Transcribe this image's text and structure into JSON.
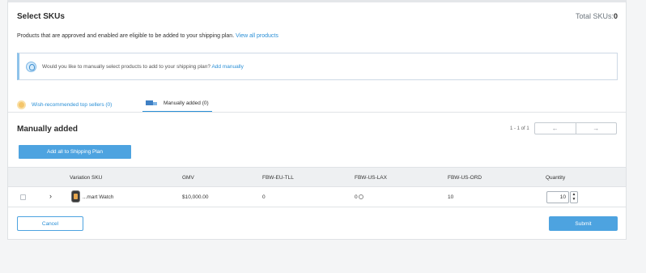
{
  "header": {
    "title": "Select SKUs",
    "total_label": "Total SKUs:",
    "total_value": "0"
  },
  "description": {
    "text": "Products that are approved and enabled are eligible to be added to your shipping plan.",
    "link": "View all products"
  },
  "info_banner": {
    "icon": "lightbulb-icon",
    "text": "Would you like to manually select products to add to your shipping plan?",
    "link": "Add manually"
  },
  "tabs": [
    {
      "label": "Wish-recommended top sellers (0)",
      "icon": "ribbon-icon",
      "active": false
    },
    {
      "label": "Manually added (0)",
      "icon": "truck-icon",
      "active": true
    }
  ],
  "section": {
    "title": "Manually added",
    "pager_text": "1 - 1 of 1",
    "prev": "←",
    "next": "→",
    "add_all_label": "Add all to Shipping Plan"
  },
  "table": {
    "columns": [
      "Variation SKU",
      "GMV",
      "FBW-EU-TLL",
      "FBW-US-LAX",
      "FBW-US-ORD",
      "Quantity"
    ],
    "rows": [
      {
        "sku": "...mart Watch",
        "gmv": "$10,000.00",
        "eu_tll": "0",
        "us_lax": "0",
        "us_ord": "10",
        "quantity": "10"
      }
    ]
  },
  "footer": {
    "cancel_label": "Cancel",
    "submit_label": "Submit"
  },
  "colors": {
    "accent": "#4da3e0",
    "link": "#2a8fd6"
  }
}
